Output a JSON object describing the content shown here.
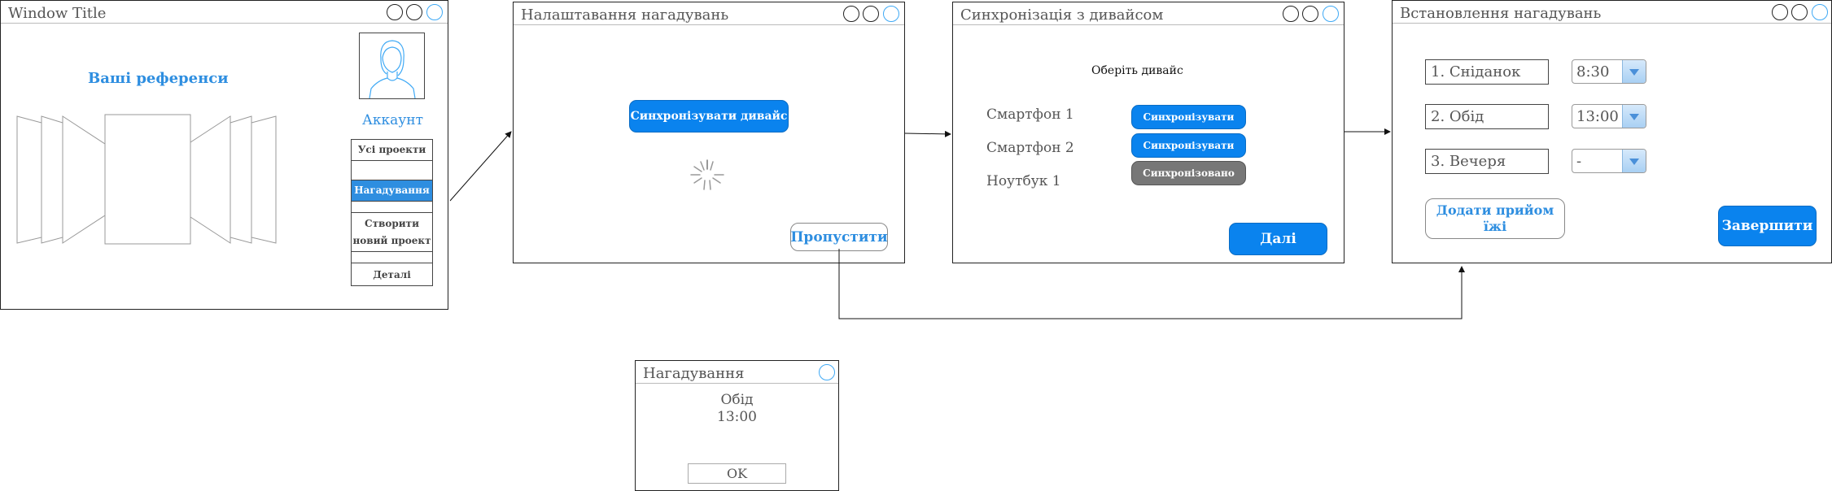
{
  "window1": {
    "title": "Window Title",
    "references_heading": "Ваші референси",
    "account_label": "Аккаунт",
    "menu": [
      {
        "label": "Усі проекти",
        "selected": false
      },
      {
        "label": "",
        "selected": false
      },
      {
        "label": "Нагадування",
        "selected": true
      },
      {
        "label": "",
        "selected": false
      },
      {
        "label": "Створити новий проект",
        "selected": false
      },
      {
        "label": "",
        "selected": false
      },
      {
        "label": "Деталі",
        "selected": false
      }
    ]
  },
  "window2": {
    "title": "Налаштавання нагадувань",
    "sync_button": "Синхронізувати дивайс",
    "skip_button": "Пропустити"
  },
  "window3": {
    "title": "Синхронізація з дивайсом",
    "prompt": "Оберіть дивайс",
    "devices": [
      {
        "name": "Смартфон 1",
        "action": "Синхронізувати",
        "state": "active"
      },
      {
        "name": "Смартфон 2",
        "action": "Синхронізувати",
        "state": "active"
      },
      {
        "name": "Ноутбук 1",
        "action": "Синхронізовано",
        "state": "done"
      }
    ],
    "next_button": "Далі"
  },
  "window4": {
    "title": "Встановлення нагадувань",
    "meals": [
      {
        "name": "1. Сніданок",
        "time": "8:30"
      },
      {
        "name": "2. Обід",
        "time": "13:00"
      },
      {
        "name": "3. Вечеря",
        "time": "-"
      }
    ],
    "add_meal_button": "Додати прийом їжі",
    "finish_button": "Завершити"
  },
  "notification": {
    "title": "Нагадування",
    "meal": "Обід",
    "time": "13:00",
    "ok_button": "OK"
  },
  "colors": {
    "accent": "#0a83ee",
    "accent_text": "#2e8ee0",
    "done_gray": "#777777",
    "control_blue": "#3fa9f5"
  }
}
